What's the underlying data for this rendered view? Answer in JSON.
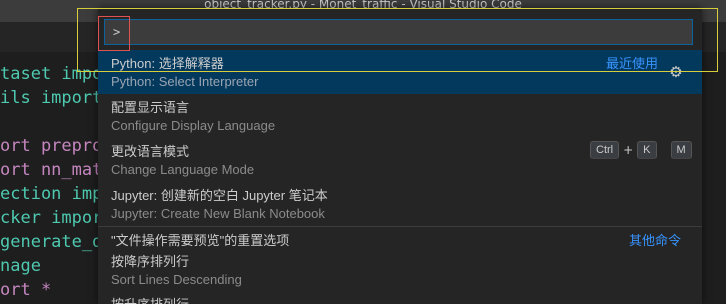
{
  "window": {
    "title": "object_tracker.py - Monet_traffic - Visual Studio Code"
  },
  "editor": {
    "lines": [
      "taset impo",
      "ils import",
      "",
      "ort prepro",
      "ort nn_mat",
      "ection imp",
      "cker impor",
      "generate_d",
      "nage",
      "ort *"
    ]
  },
  "palette": {
    "input_value": ">",
    "items": [
      {
        "label": "Python: 选择解释器",
        "detail": "Python: Select Interpreter",
        "tag": "最近使用"
      },
      {
        "label": "配置显示语言",
        "detail": "Configure Display Language"
      },
      {
        "label": "更改语言模式",
        "detail": "Change Language Mode"
      },
      {
        "label": "Jupyter: 创建新的空白 Jupyter 笔记本",
        "detail": "Jupyter: Create New Blank Notebook"
      },
      {
        "label": "\"文件操作需要预览\"的重置选项",
        "tag": "其他命令"
      },
      {
        "label": "按降序排列行",
        "detail": "Sort Lines Descending"
      },
      {
        "label": "按升序排列行"
      }
    ],
    "keybinding": {
      "key1": "Ctrl",
      "plus": "+",
      "key2": "K",
      "key3": "M"
    },
    "gear_icon": "gear-icon"
  }
}
